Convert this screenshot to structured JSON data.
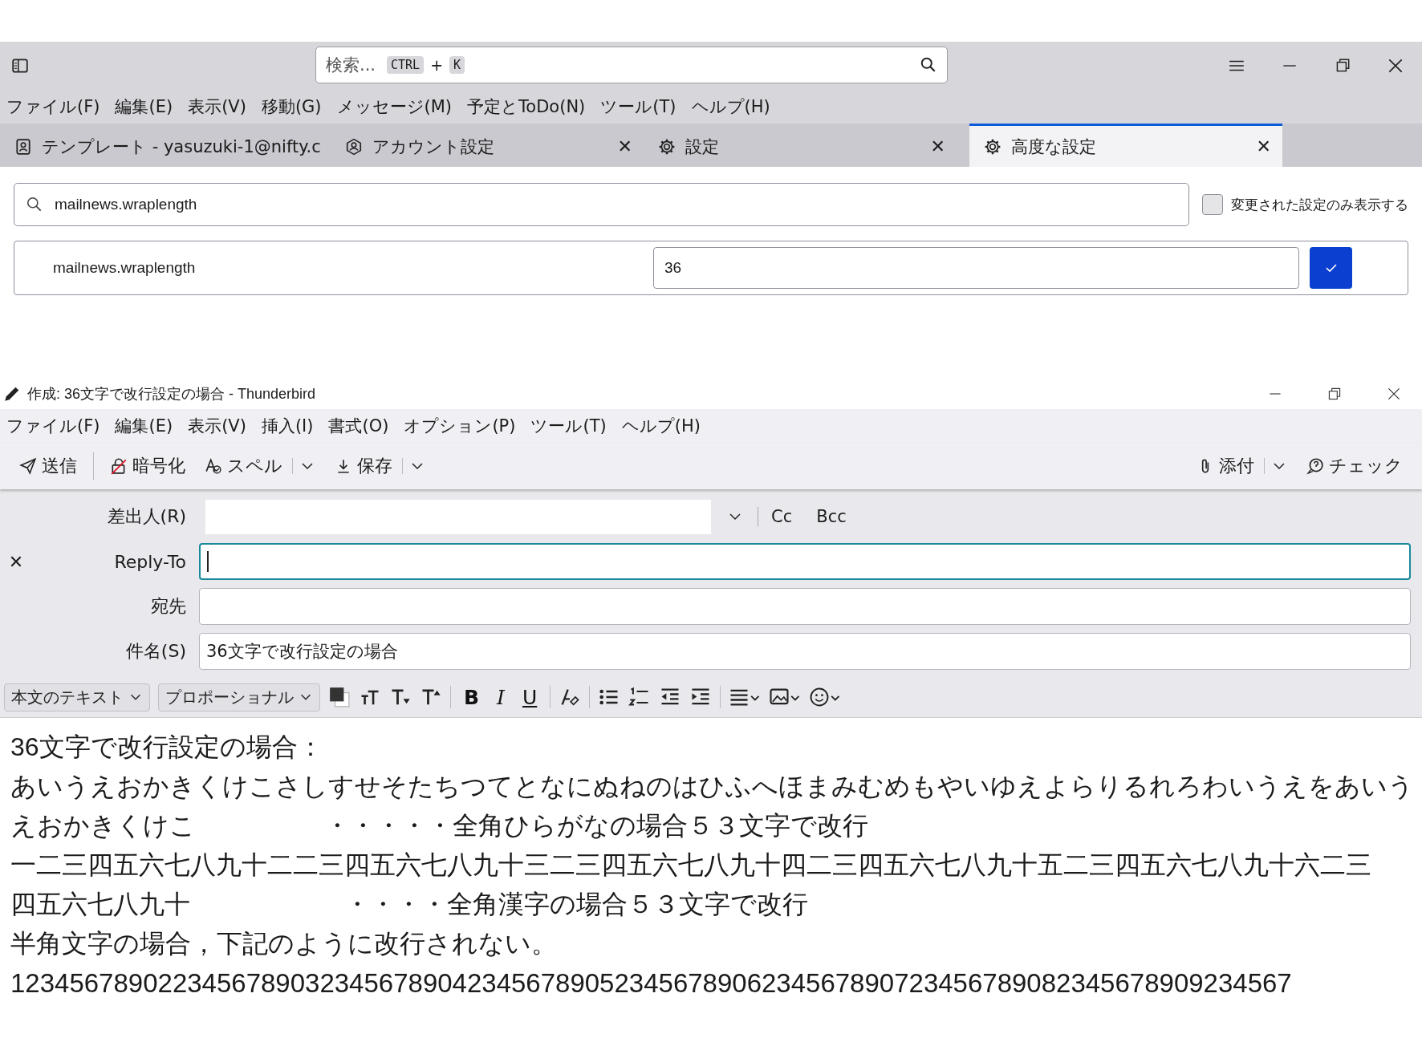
{
  "main_window": {
    "search": {
      "placeholder": "検索...",
      "keys": [
        "CTRL",
        "+",
        "K"
      ]
    },
    "menu": [
      "ファイル(F)",
      "編集(E)",
      "表示(V)",
      "移動(G)",
      "メッセージ(M)",
      "予定とToDo(N)",
      "ツール(T)",
      "ヘルプ(H)"
    ],
    "tabs": [
      {
        "label": "テンプレート - yasuzuki-1@nifty.c",
        "kind": "contact",
        "selected": false
      },
      {
        "label": "アカウント設定",
        "kind": "account",
        "close": "✕",
        "selected": false
      },
      {
        "label": "設定",
        "kind": "gear",
        "close": "✕",
        "selected": false
      },
      {
        "label": "高度な設定",
        "kind": "gear",
        "close": "✕",
        "selected": true
      }
    ],
    "config": {
      "search_value": "mailnews.wraplength",
      "modified_only": {
        "label": "変更された設定のみ表示する",
        "checked": false
      },
      "rows": [
        {
          "name": "mailnews.wraplength",
          "value": "36"
        }
      ]
    }
  },
  "compose_window": {
    "title": "作成: 36文字で改行設定の場合 - Thunderbird",
    "menu": [
      "ファイル(F)",
      "編集(E)",
      "表示(V)",
      "挿入(I)",
      "書式(O)",
      "オプション(P)",
      "ツール(T)",
      "ヘルプ(H)"
    ],
    "toolbar_left": [
      {
        "label": "送信",
        "kind": "send",
        "dropdown": false
      },
      {
        "label": "暗号化",
        "kind": "lock",
        "dropdown": false
      },
      {
        "label": "スペル",
        "kind": "spell",
        "dropdown": true
      },
      {
        "label": "保存",
        "kind": "save",
        "dropdown": true
      }
    ],
    "toolbar_right": [
      {
        "label": "添付",
        "kind": "clip",
        "dropdown": true
      },
      {
        "label": "チェック",
        "kind": "check",
        "dropdown": false
      }
    ],
    "from_label": "差出人(R)",
    "cc": "Cc",
    "bcc": "Bcc",
    "remove_glyph": "✕",
    "reply_to_label": "Reply-To",
    "to_label": "宛先",
    "subject_label": "件名(S)",
    "subject": "36文字で改行設定の場合",
    "paragraph_format": "本文のテキスト",
    "font": "プロポーショナル",
    "style_buttons": [
      "B",
      "I",
      "U"
    ],
    "body": [
      "36文字で改行設定の場合：",
      "あいうえおかきくけこさしすせそたちつてとなにぬねのはひふへほまみむめもやいゆえよらりるれろわいうえをあいう",
      "えおかきくけこ　　　　　・・・・・全角ひらがなの場合５３文字で改行",
      "一二三四五六七八九十二二三四五六七八九十三二三四五六七八九十四二三四五六七八九十五二三四五六七八九十六二三",
      "四五六七八九十　　　　　　・・・・全角漢字の場合５３文字で改行",
      "半角文字の場合，下記のように改行されない。",
      "123456789022345678903234567890423456789052345678906234567890723456789082345678909234567"
    ]
  }
}
